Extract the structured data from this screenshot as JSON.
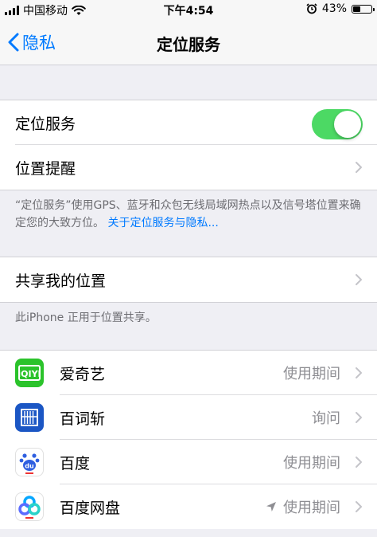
{
  "status": {
    "carrier": "中国移动",
    "time": "下午4:54",
    "battery": "43%",
    "battery_level": 0.43
  },
  "nav": {
    "back_label": "隐私",
    "title": "定位服务"
  },
  "location_services": {
    "label": "定位服务",
    "enabled": true
  },
  "location_alerts": {
    "label": "位置提醒"
  },
  "info_footer": {
    "text": "“定位服务”使用GPS、蓝牙和众包无线局域网热点以及信号塔位置来确定您的大致方位。",
    "link": "关于定位服务与隐私..."
  },
  "share_location": {
    "label": "共享我的位置"
  },
  "share_footer": {
    "text": "此iPhone 正用于位置共享。"
  },
  "apps": [
    {
      "name": "爱奇艺",
      "value": "使用期间",
      "recent_use": false,
      "icon": "iqiyi-icon",
      "color": "#2bc32b"
    },
    {
      "name": "百词斩",
      "value": "询问",
      "recent_use": false,
      "icon": "baicizhan-icon",
      "color": "#1b56c4"
    },
    {
      "name": "百度",
      "value": "使用期间",
      "recent_use": false,
      "icon": "baidu-icon",
      "color": "#2f5fe0"
    },
    {
      "name": "百度网盘",
      "value": "使用期间",
      "recent_use": true,
      "icon": "baidu-netdisk-icon",
      "color": "#06a7ff"
    }
  ]
}
